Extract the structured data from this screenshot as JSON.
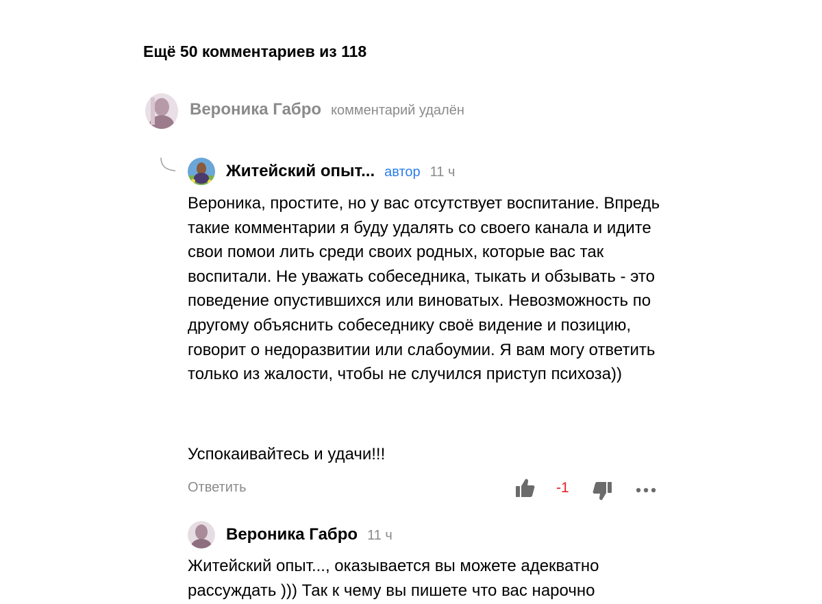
{
  "comments_header": {
    "title": "Ещё 50 комментариев из 118"
  },
  "deleted_comment": {
    "author": "Вероника Габро",
    "note": "комментарий удалён"
  },
  "author_reply": {
    "author": "Житейский опыт...",
    "badge": "автор",
    "time": "11 ч",
    "paragraphs": [
      "Вероника, простите, но у вас отсутствует воспитание. Впредь такие комментарии я буду удалять со своего канала и идите свои помои лить среди своих родных, которые вас так воспитали. Не уважать собеседника, тыкать и обзывать - это поведение опустившихся или виноватых. Невозможность по другому объяснить собеседнику своё видение и позицию, говорит о недоразвитии или слабоумии. Я вам могу ответить только из жалости, чтобы не случился приступ психоза))",
      "Успокаивайтесь и удачи!!!"
    ],
    "reply_label": "Ответить",
    "score": "-1"
  },
  "next_comment": {
    "author": "Вероника Габро",
    "time": "11 ч",
    "text": "Житейский опыт..., оказывается вы можете адекватно рассуждать ))) Так к чему вы пишете что вас нарочно"
  },
  "icons": [
    "thumbs-up-icon",
    "thumbs-down-icon",
    "more-icon",
    "reply-curve-icon"
  ],
  "colors": {
    "muted": "#8a8a8a",
    "author_badge": "#2b7de9",
    "negative_score": "#e8202a",
    "icon": "#6b6b6b"
  }
}
